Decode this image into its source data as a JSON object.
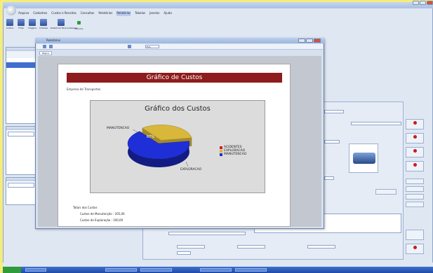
{
  "app": {
    "menus": [
      "Arquivo",
      "Cadastros",
      "Custos e Receitas",
      "Consultas",
      "Relatórios",
      "Relatórios",
      "Tabelas",
      "Janelas",
      "Ajuda"
    ]
  },
  "toolbar": {
    "buttons": [
      {
        "label": "Custos"
      },
      {
        "label": "Frota"
      },
      {
        "label": "Viagens"
      },
      {
        "label": "Cidades"
      },
      {
        "label": "Relatórios Personalizados"
      },
      {
        "label": "Veículos"
      }
    ]
  },
  "report": {
    "window_title": "Relatórios",
    "zoom": "75%",
    "tab": "Página",
    "banner": "Gráfico de Custos",
    "subtitle": "Empresa de Transportes",
    "totals_header": "Totais dos Custos",
    "total_lines": [
      "Custos de Manutenção : 205,00",
      "Custos de Exploração : 100,00"
    ]
  },
  "chart_data": {
    "type": "pie",
    "title": "Gráfico dos Custos",
    "categories": [
      "MANUTENCAO",
      "EXPLORACAO",
      "ACIDENTES"
    ],
    "values": [
      67,
      33,
      0
    ],
    "series_labels": {
      "pct": "67%",
      "manut": "MANUTENCAO",
      "explo": "EXPLORACAO"
    },
    "legend": [
      "ACIDENTES",
      "EXPLORACAO",
      "MANUTENCAO"
    ],
    "colors": {
      "ACIDENTES": "#d61c1c",
      "EXPLORACAO": "#d8b73a",
      "MANUTENCAO": "#1f2fd8"
    },
    "legend_position": "right"
  },
  "colors": {
    "banner": "#8d1c1c",
    "desktop": "#f6ec7a"
  }
}
